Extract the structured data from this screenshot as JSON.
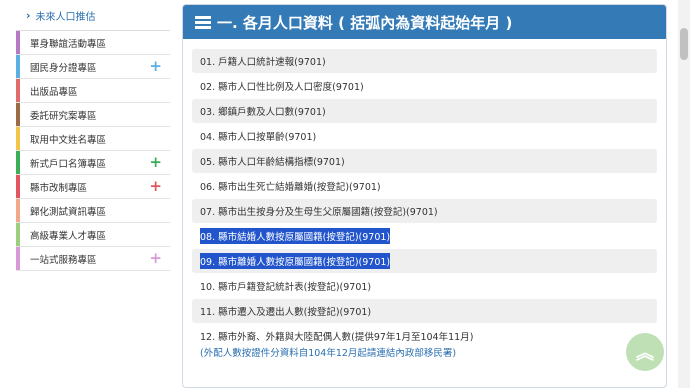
{
  "sidebar": {
    "top_item": "未來人口推估",
    "items": [
      {
        "label": "單身聯誼活動專區",
        "color": "#b47bc4",
        "plus": ""
      },
      {
        "label": "國民身分證專區",
        "color": "#5ab0e3",
        "plus": "+",
        "plus_color": "#5ab0e3"
      },
      {
        "label": "出版品專區",
        "color": "#e06b6b",
        "plus": ""
      },
      {
        "label": "委託研究案專區",
        "color": "#9b6b45",
        "plus": ""
      },
      {
        "label": "取用中文姓名專區",
        "color": "#f2c54a",
        "plus": ""
      },
      {
        "label": "新式戶口名簿專區",
        "color": "#3cae5a",
        "plus": "+",
        "plus_color": "#3cae5a"
      },
      {
        "label": "縣市改制專區",
        "color": "#e05560",
        "plus": "+",
        "plus_color": "#e05560"
      },
      {
        "label": "歸化測試資訊專區",
        "color": "#f2a88a",
        "plus": ""
      },
      {
        "label": "高級專業人才專區",
        "color": "#9ccf7c",
        "plus": ""
      },
      {
        "label": "一站式服務專區",
        "color": "#d79ad6",
        "plus": "+",
        "plus_color": "#d79ad6"
      }
    ]
  },
  "panel": {
    "title": "一. 各月人口資料 ( 括弧內為資料起始年月 )",
    "rows": [
      {
        "text": "01. 戶籍人口統計速報(9701)",
        "alt": true
      },
      {
        "text": "02. 縣市人口性比例及人口密度(9701)",
        "alt": false
      },
      {
        "text": "03. 鄉鎮戶數及人口數(9701)",
        "alt": true
      },
      {
        "text": "04. 縣市人口按單齡(9701)",
        "alt": false
      },
      {
        "text": "05. 縣市人口年齡結構指標(9701)",
        "alt": true
      },
      {
        "text": "06. 縣市出生死亡結婚離婚(按登記)(9701)",
        "alt": false
      },
      {
        "text": "07. 縣市出生按身分及生母生父原屬國籍(按登記)(9701)",
        "alt": true
      },
      {
        "text": "08. 縣市結婚人數按原屬國籍(按登記)(9701)",
        "alt": false,
        "selected": true
      },
      {
        "text": "09. 縣市離婚人數按原屬國籍(按登記)(9701)",
        "alt": true,
        "selected": true
      },
      {
        "text": "10. 縣市戶籍登記統計表(按登記)(9701)",
        "alt": false
      },
      {
        "text": "11. 縣市遷入及遷出人數(按登記)(9701)",
        "alt": true
      }
    ],
    "last_row": {
      "text": "12. 縣市外裔、外籍與大陸配偶人數(提供97年1月至104年11月)",
      "sub": "(外配人數按證件分資料自104年12月起請連結內政部移民署)"
    }
  },
  "back_to_top": "︽"
}
